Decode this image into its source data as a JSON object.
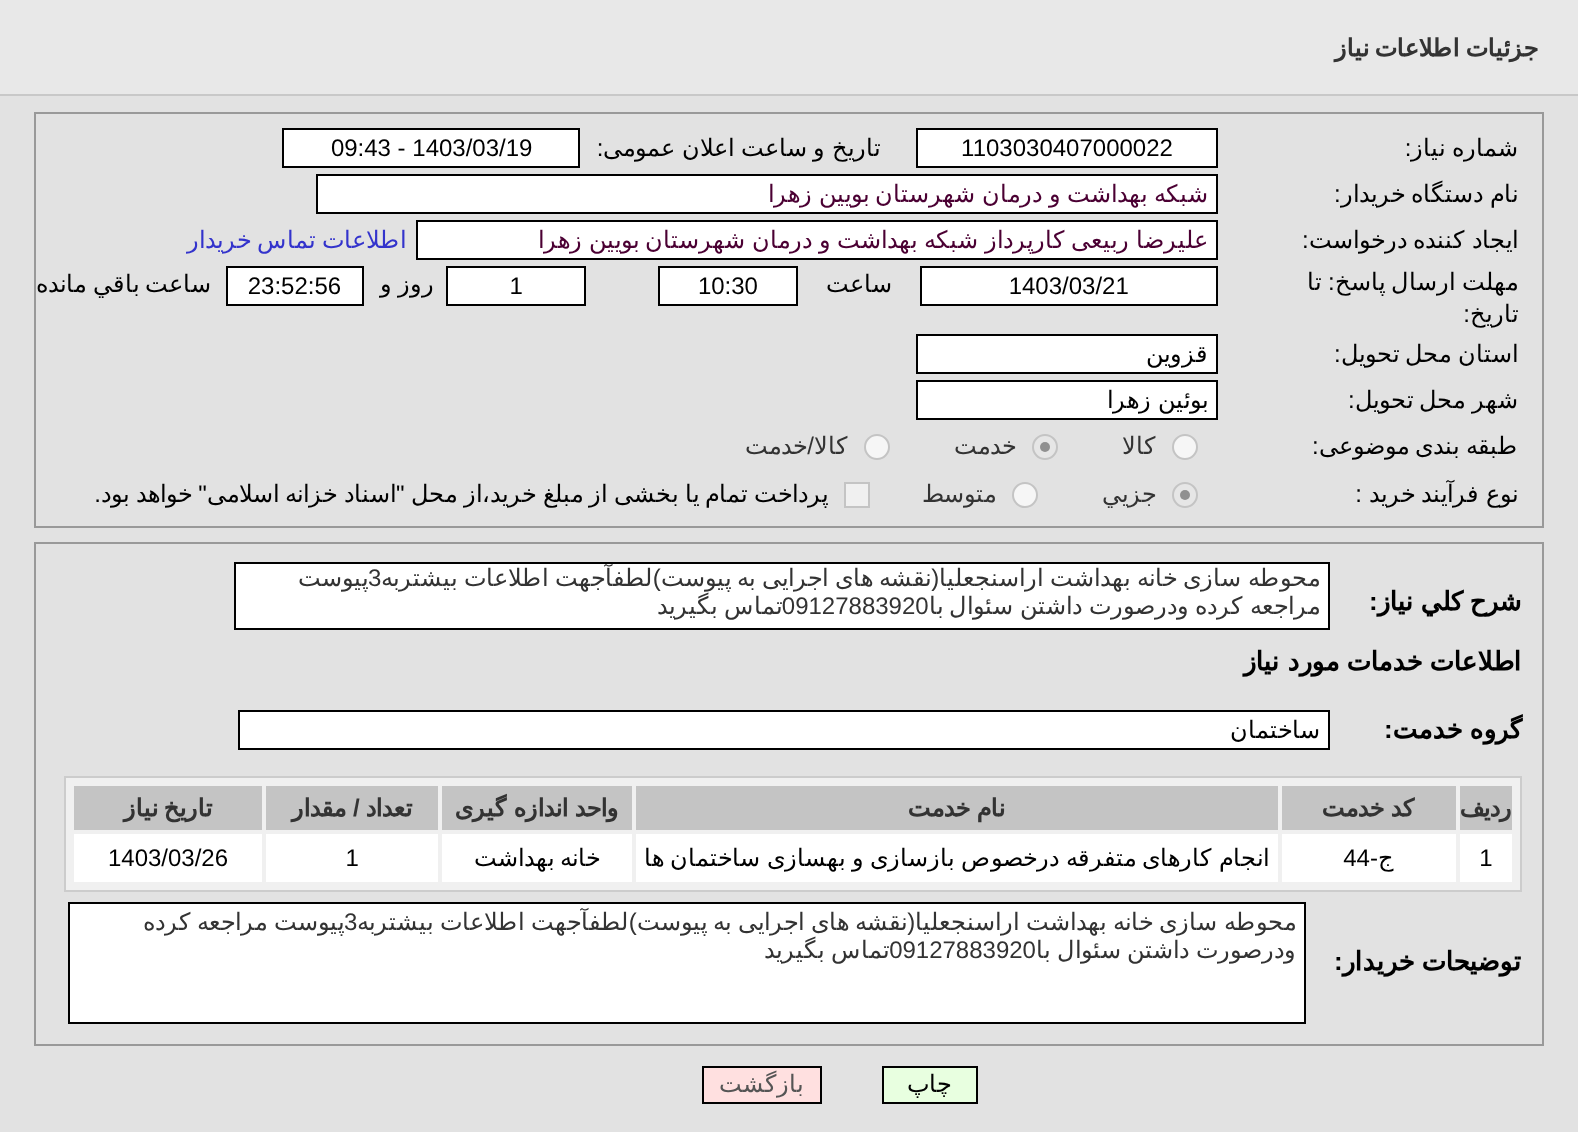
{
  "header": {
    "title": "جزئیات اطلاعات نیاز"
  },
  "need_number": {
    "label": "شماره نیاز:",
    "value": "1103030407000022"
  },
  "announce": {
    "label": "تاریخ و ساعت اعلان عمومی:",
    "value": "1403/03/19 - 09:43"
  },
  "buyer_org": {
    "label": "نام دستگاه خریدار:",
    "value": "شبکه بهداشت و درمان شهرستان بویین زهرا"
  },
  "creator": {
    "label": "ایجاد کننده درخواست:",
    "value": "علیرضا ربیعی کارپرداز شبکه بهداشت و درمان شهرستان بویین زهرا",
    "contact_link": "اطلاعات تماس خریدار"
  },
  "deadline": {
    "label": "مهلت ارسال پاسخ: تا تاریخ:",
    "date": "1403/03/21",
    "time_label": "ساعت",
    "time": "10:30",
    "days": "1",
    "days_label": "روز و",
    "remaining": "23:52:56",
    "remaining_label": "ساعت باقي مانده"
  },
  "province": {
    "label": "استان محل تحویل:",
    "value": "قزوین"
  },
  "city": {
    "label": "شهر محل تحویل:",
    "value": "بوئین زهرا"
  },
  "category": {
    "label": "طبقه بندی موضوعی:",
    "options": [
      {
        "label": "کالا",
        "selected": false
      },
      {
        "label": "خدمت",
        "selected": true
      },
      {
        "label": "کالا/خدمت",
        "selected": false
      }
    ]
  },
  "purchase_type": {
    "label": "نوع فرآیند خرید :",
    "options": [
      {
        "label": "جزیي",
        "selected": true
      },
      {
        "label": "متوسط",
        "selected": false
      }
    ],
    "treasury": {
      "checked": false,
      "label": "پرداخت تمام یا بخشی از مبلغ خرید،از محل \"اسناد خزانه اسلامی\" خواهد بود."
    }
  },
  "description": {
    "label": "شرح کلي نیاز:",
    "value": "محوطه سازی خانه بهداشت اراسنجعلیا(نقشه های اجرایی به پیوست)لطفآجهت اطلاعات بیشتربه3پیوست مراجعه کرده ودرصورت داشتن سئوال با09127883920تماس بگیرید"
  },
  "services_heading": "اطلاعات خدمات مورد نیاز",
  "service_group": {
    "label": "گروه خدمت:",
    "value": "ساختمان"
  },
  "table": {
    "columns": [
      "ردیف",
      "کد خدمت",
      "نام خدمت",
      "واحد اندازه گیری",
      "تعداد / مقدار",
      "تاریخ نیاز"
    ],
    "rows": [
      [
        "1",
        "ج-44",
        "انجام کارهای متفرقه درخصوص بازسازی و بهسازی ساختمان ها",
        "خانه بهداشت",
        "1",
        "1403/03/26"
      ]
    ]
  },
  "buyer_notes": {
    "label": "توضیحات خریدار:",
    "value": "محوطه سازی خانه بهداشت اراسنجعلیا(نقشه های اجرایی به پیوست)لطفآجهت اطلاعات بیشتربه3پیوست مراجعه کرده ودرصورت داشتن سئوال با09127883920تماس بگیرید"
  },
  "buttons": [
    {
      "label": "چاپ",
      "kind": "print"
    },
    {
      "label": "بازگشت",
      "kind": "back"
    }
  ]
}
